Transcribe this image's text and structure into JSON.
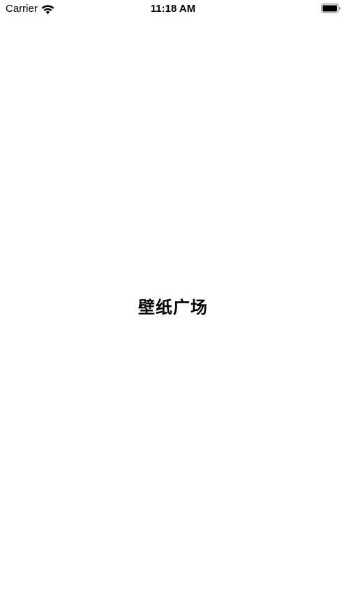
{
  "status_bar": {
    "carrier": "Carrier",
    "time": "11:18 AM",
    "wifi_icon": "wifi-icon",
    "battery_icon": "battery-icon"
  },
  "splash": {
    "title": "壁纸广场"
  },
  "colors": {
    "background": "#ffffff",
    "text": "#000000"
  }
}
